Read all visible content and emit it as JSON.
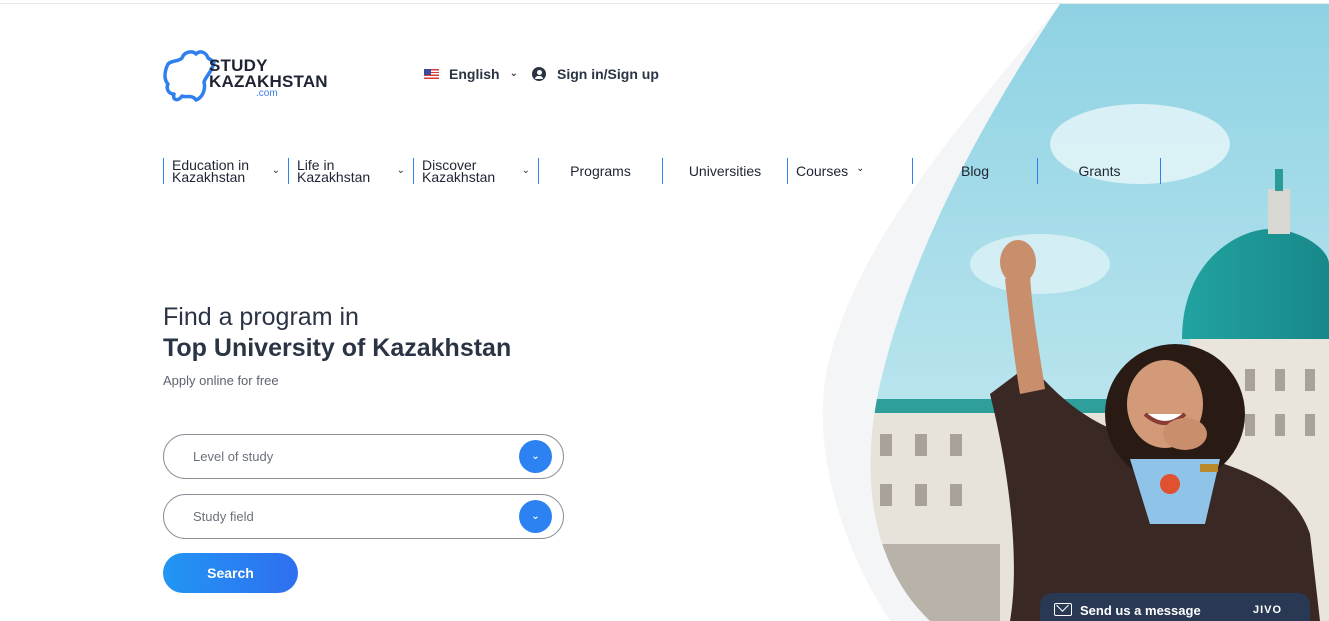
{
  "logo": {
    "line1": "STUDY",
    "line2": "KAZAKHSTAN",
    "line3": ".com"
  },
  "topbar": {
    "language": "English",
    "signin": "Sign in/Sign up"
  },
  "nav": {
    "items": [
      {
        "line1": "Education in",
        "line2": "Kazakhstan",
        "dropdown": true
      },
      {
        "line1": "Life in",
        "line2": "Kazakhstan",
        "dropdown": true
      },
      {
        "line1": "Discover",
        "line2": "Kazakhstan",
        "dropdown": true
      },
      {
        "label": "Programs"
      },
      {
        "label": "Universities"
      },
      {
        "label": "Courses",
        "dropdown": true
      },
      {
        "label": "Blog"
      },
      {
        "label": "Grants"
      }
    ]
  },
  "hero": {
    "line1": "Find a program in",
    "line2": "Top University of Kazakhstan",
    "subtitle": "Apply online for free"
  },
  "form": {
    "level_placeholder": "Level of study",
    "field_placeholder": "Study field",
    "search_label": "Search"
  },
  "chat": {
    "label": "Send us a message",
    "brand": "JIVO"
  },
  "colors": {
    "accent": "#2c82f0",
    "text": "#2b3445",
    "chat_bg": "#293954",
    "nav_divider": "#2f80ed"
  },
  "icons": {
    "flag": "us-flag-icon",
    "user": "user-circle-icon",
    "dropdown": "chevron-down-icon",
    "mail": "mail-icon"
  }
}
